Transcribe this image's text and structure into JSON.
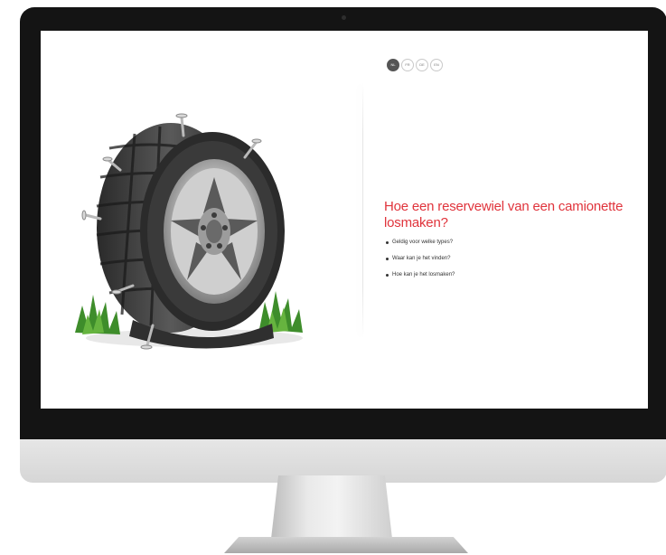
{
  "screen": {
    "language_switcher": [
      {
        "label": "NL",
        "active": true
      },
      {
        "label": "FR",
        "active": false
      },
      {
        "label": "DE",
        "active": false
      },
      {
        "label": "EN",
        "active": false
      }
    ],
    "title": "Hoe een reservewiel van een camionette losmaken?",
    "topics": [
      "Geldig voor welke types?",
      "Waar kan je het vinden?",
      "Hoe kan je het losmaken?"
    ]
  },
  "colors": {
    "accent": "#e0343c",
    "bezel": "#141414",
    "body_text": "#333333"
  },
  "icons": {
    "hero_image": "flat-tire-with-nails-on-grass"
  }
}
